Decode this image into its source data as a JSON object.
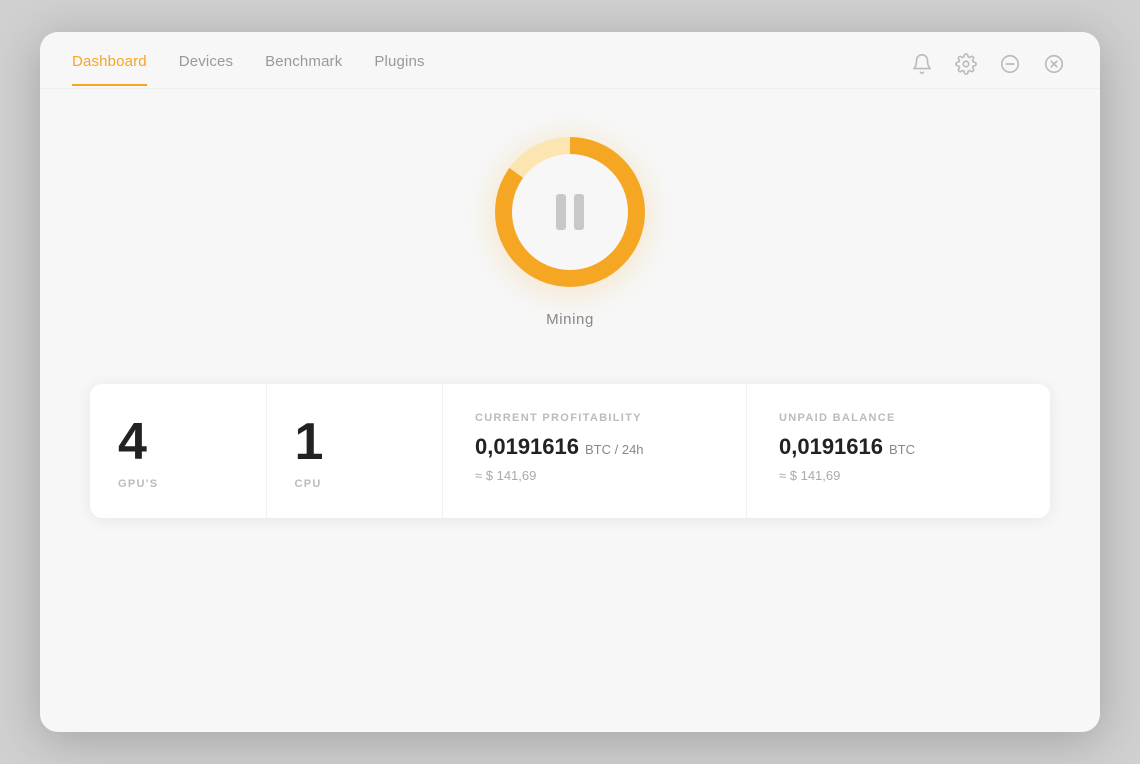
{
  "nav": {
    "items": [
      {
        "id": "dashboard",
        "label": "Dashboard",
        "active": true
      },
      {
        "id": "devices",
        "label": "Devices",
        "active": false
      },
      {
        "id": "benchmark",
        "label": "Benchmark",
        "active": false
      },
      {
        "id": "plugins",
        "label": "Plugins",
        "active": false
      }
    ]
  },
  "window_controls": {
    "bell_icon": "🔔",
    "settings_icon": "⚙",
    "minimize_icon": "—",
    "close_icon": "✕"
  },
  "mining": {
    "label": "Mining",
    "status": "paused"
  },
  "stats": {
    "gpu_count": "4",
    "gpu_label": "GPU'S",
    "cpu_count": "1",
    "cpu_label": "CPU",
    "profitability_label": "CURRENT PROFITABILITY",
    "profitability_value": "0,0191616",
    "profitability_unit": "BTC / 24h",
    "profitability_approx": "≈ $ 141,69",
    "unpaid_label": "UNPAID BALANCE",
    "unpaid_value": "0,0191616",
    "unpaid_unit": "BTC",
    "unpaid_approx": "≈ $ 141,69"
  }
}
